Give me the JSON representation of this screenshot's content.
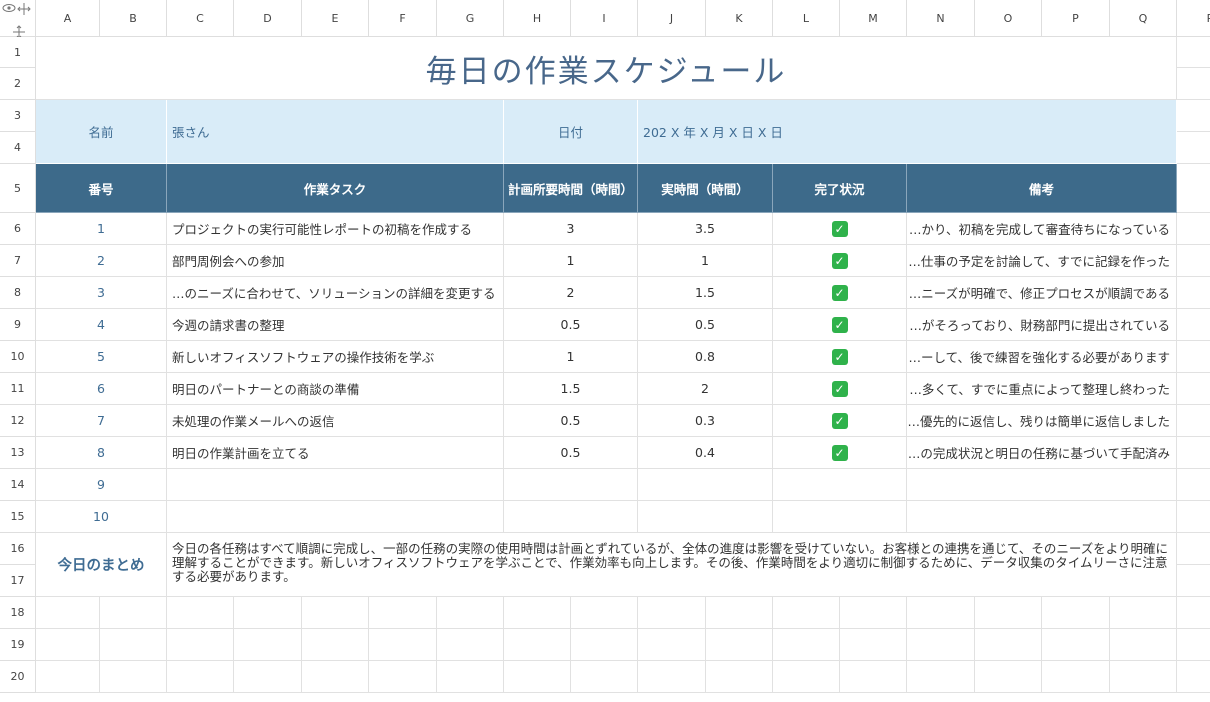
{
  "columns": [
    "A",
    "B",
    "C",
    "D",
    "E",
    "F",
    "G",
    "H",
    "I",
    "J",
    "K",
    "L",
    "M",
    "N",
    "O",
    "P",
    "Q",
    "R"
  ],
  "rows": [
    "1",
    "2",
    "3",
    "4",
    "5",
    "6",
    "7",
    "8",
    "9",
    "10",
    "11",
    "12",
    "13",
    "14",
    "15",
    "16",
    "17",
    "18",
    "19",
    "20"
  ],
  "title": "毎日の作業スケジュール",
  "info": {
    "name_label": "名前",
    "name_value": "張さん",
    "date_label": "日付",
    "date_value": "202 X 年 X 月 X 日 X 日"
  },
  "headers": {
    "no": "番号",
    "task": "作業タスク",
    "planned": "計画所要時間（時間）",
    "actual": "実時間（時間）",
    "status": "完了状況",
    "remarks": "備考"
  },
  "tasks": [
    {
      "no": "1",
      "task": "プロジェクトの実行可能性レポートの初稿を作成する",
      "planned": "3",
      "actual": "3.5",
      "done": "✓",
      "remark": "…かり、初稿を完成して審査待ちになっている"
    },
    {
      "no": "2",
      "task": "部門周例会への参加",
      "planned": "1",
      "actual": "1",
      "done": "✓",
      "remark": "…仕事の予定を討論して、すでに記録を作った"
    },
    {
      "no": "3",
      "task": "…のニーズに合わせて、ソリューションの詳細を変更する",
      "planned": "2",
      "actual": "1.5",
      "done": "✓",
      "remark": "…ニーズが明確で、修正プロセスが順調である"
    },
    {
      "no": "4",
      "task": "今週の請求書の整理",
      "planned": "0.5",
      "actual": "0.5",
      "done": "✓",
      "remark": "…がそろっており、財務部門に提出されている"
    },
    {
      "no": "5",
      "task": "新しいオフィスソフトウェアの操作技術を学ぶ",
      "planned": "1",
      "actual": "0.8",
      "done": "✓",
      "remark": "…ーして、後で練習を強化する必要があります"
    },
    {
      "no": "6",
      "task": "明日のパートナーとの商談の準備",
      "planned": "1.5",
      "actual": "2",
      "done": "✓",
      "remark": "…多くて、すでに重点によって整理し終わった"
    },
    {
      "no": "7",
      "task": "未処理の作業メールへの返信",
      "planned": "0.5",
      "actual": "0.3",
      "done": "✓",
      "remark": "…優先的に返信し、残りは簡単に返信しました"
    },
    {
      "no": "8",
      "task": "明日の作業計画を立てる",
      "planned": "0.5",
      "actual": "0.4",
      "done": "✓",
      "remark": "…の完成状況と明日の任務に基づいて手配済み"
    },
    {
      "no": "9",
      "task": "",
      "planned": "",
      "actual": "",
      "done": "",
      "remark": ""
    },
    {
      "no": "10",
      "task": "",
      "planned": "",
      "actual": "",
      "done": "",
      "remark": ""
    }
  ],
  "summary": {
    "label": "今日のまとめ",
    "text": "今日の各任務はすべて順調に完成し、一部の任務の実際の使用時間は計画とずれているが、全体の進度は影響を受けていない。お客様との連携を通じて、そのニーズをより明確に理解することができます。新しいオフィスソフトウェアを学ぶことで、作業効率も向上します。その後、作業時間をより適切に制御するために、データ収集のタイムリーさに注意する必要があります。"
  },
  "colors": {
    "title": "#48678a",
    "info_bg": "#d9ecf8",
    "header_bg": "#3d6a8a",
    "check_bg": "#2fb24b"
  }
}
